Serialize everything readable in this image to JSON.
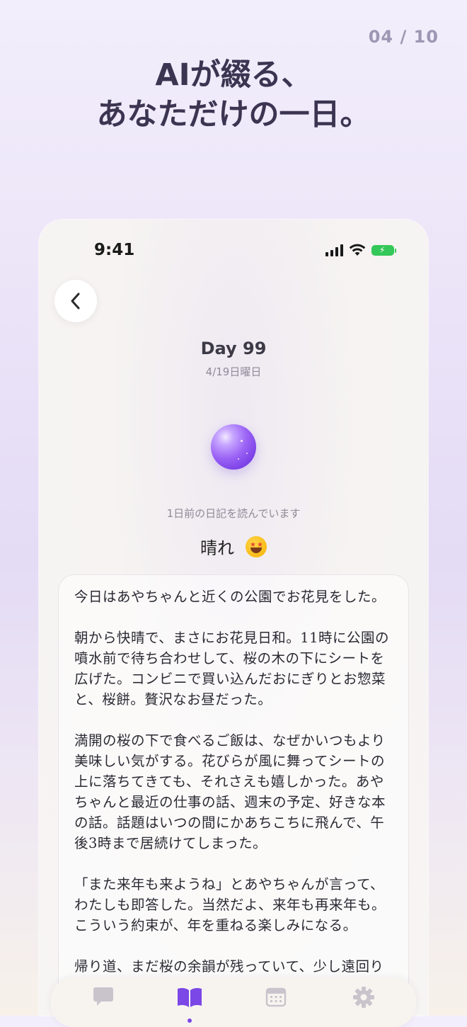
{
  "page_counter": "04 / 10",
  "headline": [
    "AIが綴る、",
    "あなただけの一日。"
  ],
  "status_bar": {
    "time": "9:41"
  },
  "diary": {
    "day_title": "Day 99",
    "date": "4/19日曜日",
    "reading_status": "1日前の日記を読んでいます",
    "weather": "晴れ",
    "mood_icon": "star-struck-emoji-icon",
    "body": "今日はあやちゃんと近くの公園でお花見をした。\n\n朝から快晴で、まさにお花見日和。11時に公園の噴水前で待ち合わせして、桜の木の下にシートを広げた。コンビニで買い込んだおにぎりとお惣菜と、桜餅。贅沢なお昼だった。\n\n満開の桜の下で食べるご飯は、なぜかいつもより美味しい気がする。花びらが風に舞ってシートの上に落ちてきても、それさえも嬉しかった。あやちゃんと最近の仕事の話、週末の予定、好きな本の話。話題はいつの間にかあちこちに飛んで、午後3時まで居続けてしまった。\n\n「また来年も来ようね」とあやちゃんが言って、わたしも即答した。当然だよ、来年も再来年も。こういう約束が、年を重ねる楽しみになる。\n\n帰り道、まだ桜の余韻が残っていて、少し遠回り"
  },
  "tab_bar": {
    "tabs": [
      {
        "icon": "chat-bubble-icon",
        "active": false
      },
      {
        "icon": "book-icon",
        "active": true
      },
      {
        "icon": "calendar-icon",
        "active": false
      },
      {
        "icon": "gear-icon",
        "active": false
      }
    ]
  },
  "colors": {
    "accent": "#7b47e6",
    "headline": "#3b3552",
    "tab_inactive": "#c9c4cc",
    "battery": "#34c759"
  }
}
